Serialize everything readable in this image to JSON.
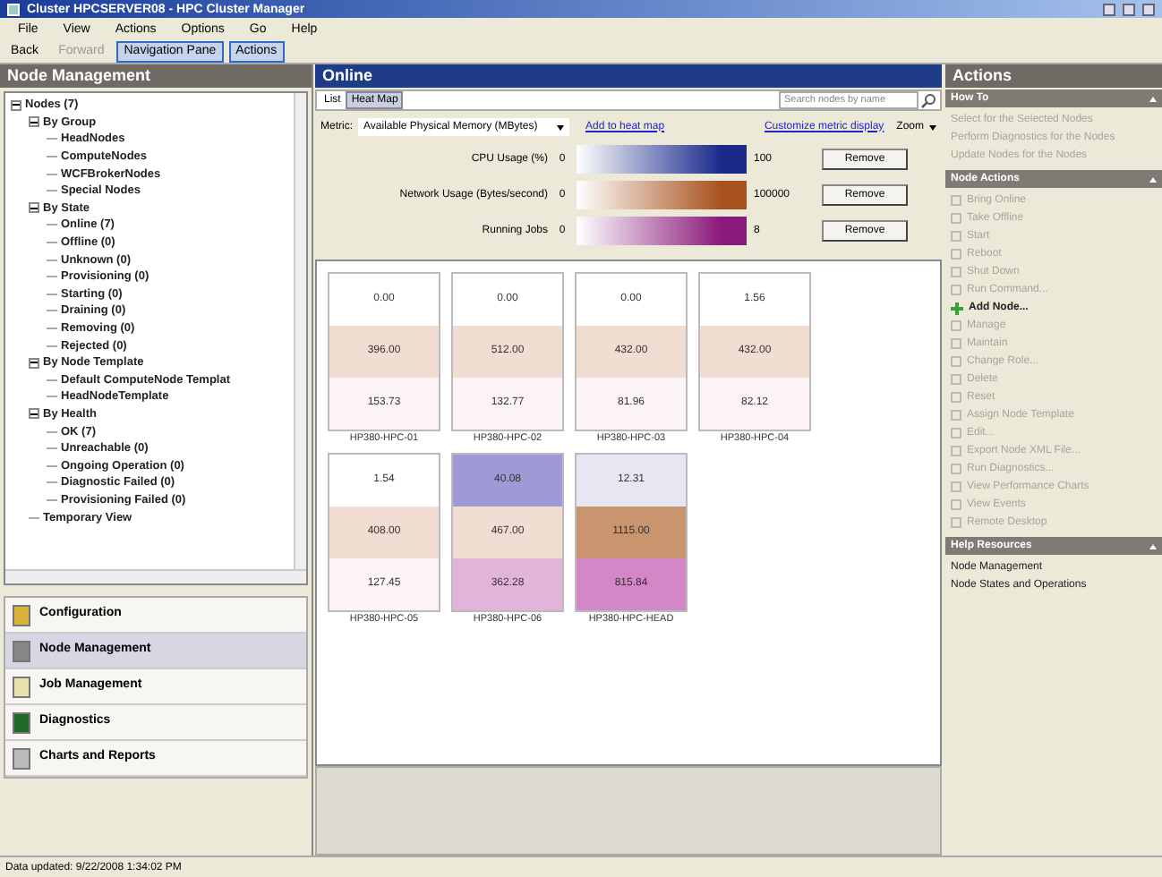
{
  "window": {
    "title": "Cluster HPCSERVER08 - HPC Cluster Manager"
  },
  "menu": [
    "File",
    "View",
    "Actions",
    "Options",
    "Go",
    "Help"
  ],
  "toolbar": [
    {
      "label": "Back",
      "disabled": false,
      "selected": false
    },
    {
      "label": "Forward",
      "disabled": true,
      "selected": false
    },
    {
      "label": "Navigation Pane",
      "disabled": false,
      "selected": true
    },
    {
      "label": "Actions",
      "disabled": false,
      "selected": true
    }
  ],
  "navigation": {
    "title": "Node Management",
    "tree": [
      {
        "label": "Nodes (7)",
        "expanded": true,
        "children": [
          {
            "label": "By Group",
            "expanded": true,
            "children": [
              {
                "label": "HeadNodes"
              },
              {
                "label": "ComputeNodes"
              },
              {
                "label": "WCFBrokerNodes"
              },
              {
                "label": "Special Nodes"
              }
            ]
          },
          {
            "label": "By State",
            "expanded": true,
            "children": [
              {
                "label": "Online (7)"
              },
              {
                "label": "Offline (0)"
              },
              {
                "label": "Unknown (0)"
              },
              {
                "label": "Provisioning (0)"
              },
              {
                "label": "Starting (0)"
              },
              {
                "label": "Draining (0)"
              },
              {
                "label": "Removing (0)"
              },
              {
                "label": "Rejected (0)"
              }
            ]
          },
          {
            "label": "By Node Template",
            "expanded": true,
            "children": [
              {
                "label": "Default ComputeNode Templat"
              },
              {
                "label": "HeadNodeTemplate"
              }
            ]
          },
          {
            "label": "By Health",
            "expanded": true,
            "children": [
              {
                "label": "OK (7)"
              },
              {
                "label": "Unreachable (0)"
              },
              {
                "label": "Ongoing Operation (0)"
              },
              {
                "label": "Diagnostic Failed (0)"
              },
              {
                "label": "Provisioning Failed (0)"
              }
            ]
          },
          {
            "label": "Temporary View"
          }
        ]
      }
    ],
    "sections": [
      {
        "label": "Configuration",
        "kind": "config",
        "selected": false
      },
      {
        "label": "Node Management",
        "kind": "nodes",
        "selected": true
      },
      {
        "label": "Job Management",
        "kind": "jobs",
        "selected": false
      },
      {
        "label": "Diagnostics",
        "kind": "diag",
        "selected": false
      },
      {
        "label": "Charts and Reports",
        "kind": "charts",
        "selected": false
      }
    ]
  },
  "center": {
    "title": "Online",
    "tabs": [
      {
        "label": "List",
        "selected": false
      },
      {
        "label": "Heat Map",
        "selected": true
      }
    ],
    "search": {
      "placeholder": "Search nodes by name"
    },
    "metric_label": "Metric:",
    "metric_value": "Available Physical Memory (MBytes)",
    "add_link": "Add to heat map",
    "customize_link": "Customize metric display",
    "zoom": "Zoom",
    "legend": [
      {
        "label": "CPU Usage (%)",
        "min": "0",
        "max": "100",
        "color": "#1a2a8a",
        "button": "Remove"
      },
      {
        "label": "Network Usage (Bytes/second)",
        "min": "0",
        "max": "100000",
        "color": "#a8521e",
        "button": "Remove"
      },
      {
        "label": "Running Jobs",
        "min": "0",
        "max": "8",
        "color": "#8a1a7a",
        "button": "Remove"
      }
    ],
    "nodes": [
      {
        "name": "HP380-HPC-01",
        "cells": [
          {
            "value": "0.00",
            "color": "#ffffff"
          },
          {
            "value": "396.00",
            "color": "#f2ddd2"
          },
          {
            "value": "153.73",
            "color": "#fbf3f6"
          }
        ]
      },
      {
        "name": "HP380-HPC-02",
        "cells": [
          {
            "value": "0.00",
            "color": "#ffffff"
          },
          {
            "value": "512.00",
            "color": "#f2ddd2"
          },
          {
            "value": "132.77",
            "color": "#fbf3f6"
          }
        ]
      },
      {
        "name": "HP380-HPC-03",
        "cells": [
          {
            "value": "0.00",
            "color": "#ffffff"
          },
          {
            "value": "432.00",
            "color": "#f2ddd2"
          },
          {
            "value": "81.96",
            "color": "#fbf3f6"
          }
        ]
      },
      {
        "name": "HP380-HPC-04",
        "cells": [
          {
            "value": "1.56",
            "color": "#ffffff"
          },
          {
            "value": "432.00",
            "color": "#f2ddd2"
          },
          {
            "value": "82.12",
            "color": "#fbf3f6"
          }
        ]
      },
      {
        "name": "HP380-HPC-05",
        "cells": [
          {
            "value": "1.54",
            "color": "#ffffff"
          },
          {
            "value": "408.00",
            "color": "#f2ddd2"
          },
          {
            "value": "127.45",
            "color": "#fbf3f6"
          }
        ]
      },
      {
        "name": "HP380-HPC-06",
        "cells": [
          {
            "value": "40.08",
            "color": "#9d9ad6"
          },
          {
            "value": "467.00",
            "color": "#f2ddd2"
          },
          {
            "value": "362.28",
            "color": "#e3b4d9"
          }
        ]
      },
      {
        "name": "HP380-HPC-HEAD",
        "cells": [
          {
            "value": "12.31",
            "color": "#e8e6f2"
          },
          {
            "value": "1115.00",
            "color": "#c9956e"
          },
          {
            "value": "815.84",
            "color": "#d487c7"
          }
        ]
      }
    ]
  },
  "actions": {
    "title": "Actions",
    "groups": [
      {
        "title": "How To",
        "expanded": true,
        "items": [
          {
            "label": "Select for the Selected Nodes",
            "kind": "text",
            "disabled": true
          },
          {
            "label": "Perform Diagnostics for the Nodes",
            "kind": "text",
            "disabled": true
          },
          {
            "label": "Update Nodes for the Nodes",
            "kind": "text",
            "disabled": true
          }
        ]
      },
      {
        "title": "Node Actions",
        "expanded": true,
        "items": [
          {
            "label": "Bring Online",
            "kind": "icon",
            "disabled": true
          },
          {
            "label": "Take Offline",
            "kind": "icon",
            "disabled": true
          },
          {
            "label": "Start",
            "kind": "icon",
            "disabled": true
          },
          {
            "label": "Reboot",
            "kind": "icon",
            "disabled": true
          },
          {
            "label": "Shut Down",
            "kind": "icon",
            "disabled": true
          },
          {
            "label": "Run Command...",
            "kind": "icon",
            "disabled": true
          },
          {
            "label": "Add Node...",
            "kind": "add",
            "disabled": false
          },
          {
            "label": "Manage",
            "kind": "icon",
            "disabled": true
          },
          {
            "label": "Maintain",
            "kind": "icon",
            "disabled": true
          },
          {
            "label": "Change Role...",
            "kind": "icon",
            "disabled": true
          },
          {
            "label": "Delete",
            "kind": "icon",
            "disabled": true
          },
          {
            "label": "Reset",
            "kind": "icon",
            "disabled": true
          },
          {
            "label": "Assign Node Template",
            "kind": "icon",
            "disabled": true
          },
          {
            "label": "Edit...",
            "kind": "icon",
            "disabled": true
          },
          {
            "label": "Export Node XML File...",
            "kind": "icon",
            "disabled": true
          },
          {
            "label": "Run Diagnostics...",
            "kind": "icon",
            "disabled": true
          },
          {
            "label": "View Performance Charts",
            "kind": "icon",
            "disabled": true
          },
          {
            "label": "View Events",
            "kind": "icon",
            "disabled": true
          },
          {
            "label": "Remote Desktop",
            "kind": "icon",
            "disabled": true
          }
        ]
      },
      {
        "title": "Help Resources",
        "expanded": true,
        "items": [
          {
            "label": "Node Management",
            "kind": "text",
            "disabled": false
          },
          {
            "label": "Node States and Operations",
            "kind": "text",
            "disabled": false
          }
        ]
      }
    ]
  },
  "status_bar": "Data updated: 9/22/2008 1:34:02 PM"
}
